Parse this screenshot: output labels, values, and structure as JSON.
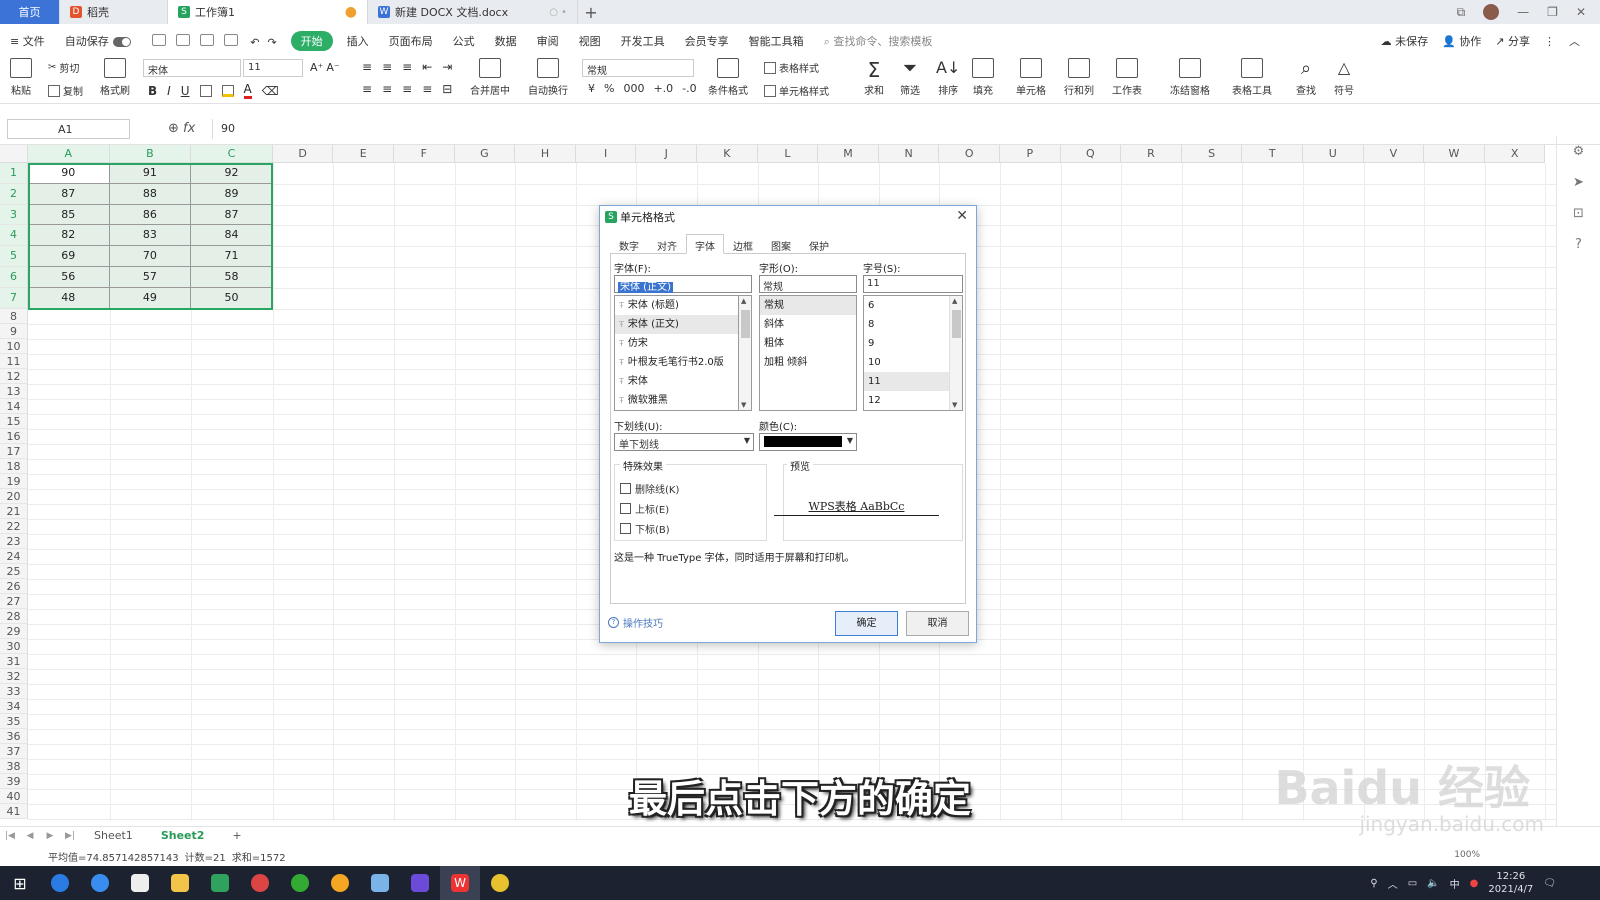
{
  "tabs": [
    {
      "label": "首页"
    },
    {
      "label": "稻壳"
    },
    {
      "label": "工作簿1"
    },
    {
      "label": "新建 DOCX 文档.docx"
    }
  ],
  "menu": {
    "file": "≡ 文件",
    "autosave": "自动保存",
    "items": [
      "开始",
      "插入",
      "页面布局",
      "公式",
      "数据",
      "审阅",
      "视图",
      "开发工具",
      "会员专享",
      "智能工具箱"
    ],
    "search_placeholder": "查找命令、搜索模板",
    "right": [
      "未保存",
      "协作",
      "分享"
    ]
  },
  "ribbon": {
    "paste": "粘贴",
    "cut": "剪切",
    "copy": "复制",
    "format_painter": "格式刷",
    "font_name": "宋体",
    "font_size": "11",
    "merge": "合并居中",
    "wrap": "自动换行",
    "num_format": "常规",
    "cond_format": "条件格式",
    "table_style": "表格样式",
    "cell_style": "单元格样式",
    "sum": "求和",
    "filter": "筛选",
    "sort": "排序",
    "fill": "填充",
    "cell": "单元格",
    "rowcol": "行和列",
    "worksheet": "工作表",
    "freeze": "冻结窗格",
    "table_tools": "表格工具",
    "find": "查找",
    "symbol": "符号"
  },
  "formula_bar": {
    "cell_ref": "A1",
    "fx": "fx",
    "value": "90"
  },
  "columns": [
    "A",
    "B",
    "C",
    "D",
    "E",
    "F",
    "G",
    "H",
    "I",
    "J",
    "K",
    "L",
    "M",
    "N",
    "O",
    "P",
    "Q",
    "R",
    "S",
    "T",
    "U",
    "V",
    "W",
    "X"
  ],
  "table": [
    [
      "90",
      "91",
      "92"
    ],
    [
      "87",
      "88",
      "89"
    ],
    [
      "85",
      "86",
      "87"
    ],
    [
      "82",
      "83",
      "84"
    ],
    [
      "69",
      "70",
      "71"
    ],
    [
      "56",
      "57",
      "58"
    ],
    [
      "48",
      "49",
      "50"
    ]
  ],
  "dialog": {
    "title": "单元格格式",
    "tabs": [
      "数字",
      "对齐",
      "字体",
      "边框",
      "图案",
      "保护"
    ],
    "font_label": "字体(F):",
    "font_value": "宋体 (正文)",
    "font_list": [
      "宋体 (标题)",
      "宋体 (正文)",
      "仿宋",
      "叶根友毛笔行书2.0版",
      "宋体",
      "微软雅黑"
    ],
    "style_label": "字形(O):",
    "style_value": "常规",
    "style_list": [
      "常规",
      "斜体",
      "粗体",
      "加粗 倾斜"
    ],
    "size_label": "字号(S):",
    "size_value": "11",
    "size_list": [
      "6",
      "8",
      "9",
      "10",
      "11",
      "12"
    ],
    "underline_label": "下划线(U):",
    "underline_value": "单下划线",
    "color_label": "颜色(C):",
    "effects_label": "特殊效果",
    "effects": [
      "删除线(K)",
      "上标(E)",
      "下标(B)"
    ],
    "preview_label": "预览",
    "preview_text": "WPS表格  AaBbCc",
    "info": "这是一种 TrueType 字体，同时适用于屏幕和打印机。",
    "tips": "操作技巧",
    "ok": "确定",
    "cancel": "取消"
  },
  "sheets": [
    "Sheet1",
    "Sheet2"
  ],
  "status": {
    "avg": "平均值=74.857142857143",
    "count": "计数=21",
    "sum": "求和=1572",
    "zoom": "100%"
  },
  "clock": {
    "time": "12:26",
    "date": "2021/4/7"
  },
  "tray_ime": "中",
  "subtitle": "最后点击下方的确定",
  "watermark": "Baidu 经验",
  "watermark_url": "jingyan.baidu.com",
  "colors": {
    "accent_green": "#2dae67",
    "home_tab": "#3b73d6",
    "taskbar": "#1c2230"
  }
}
